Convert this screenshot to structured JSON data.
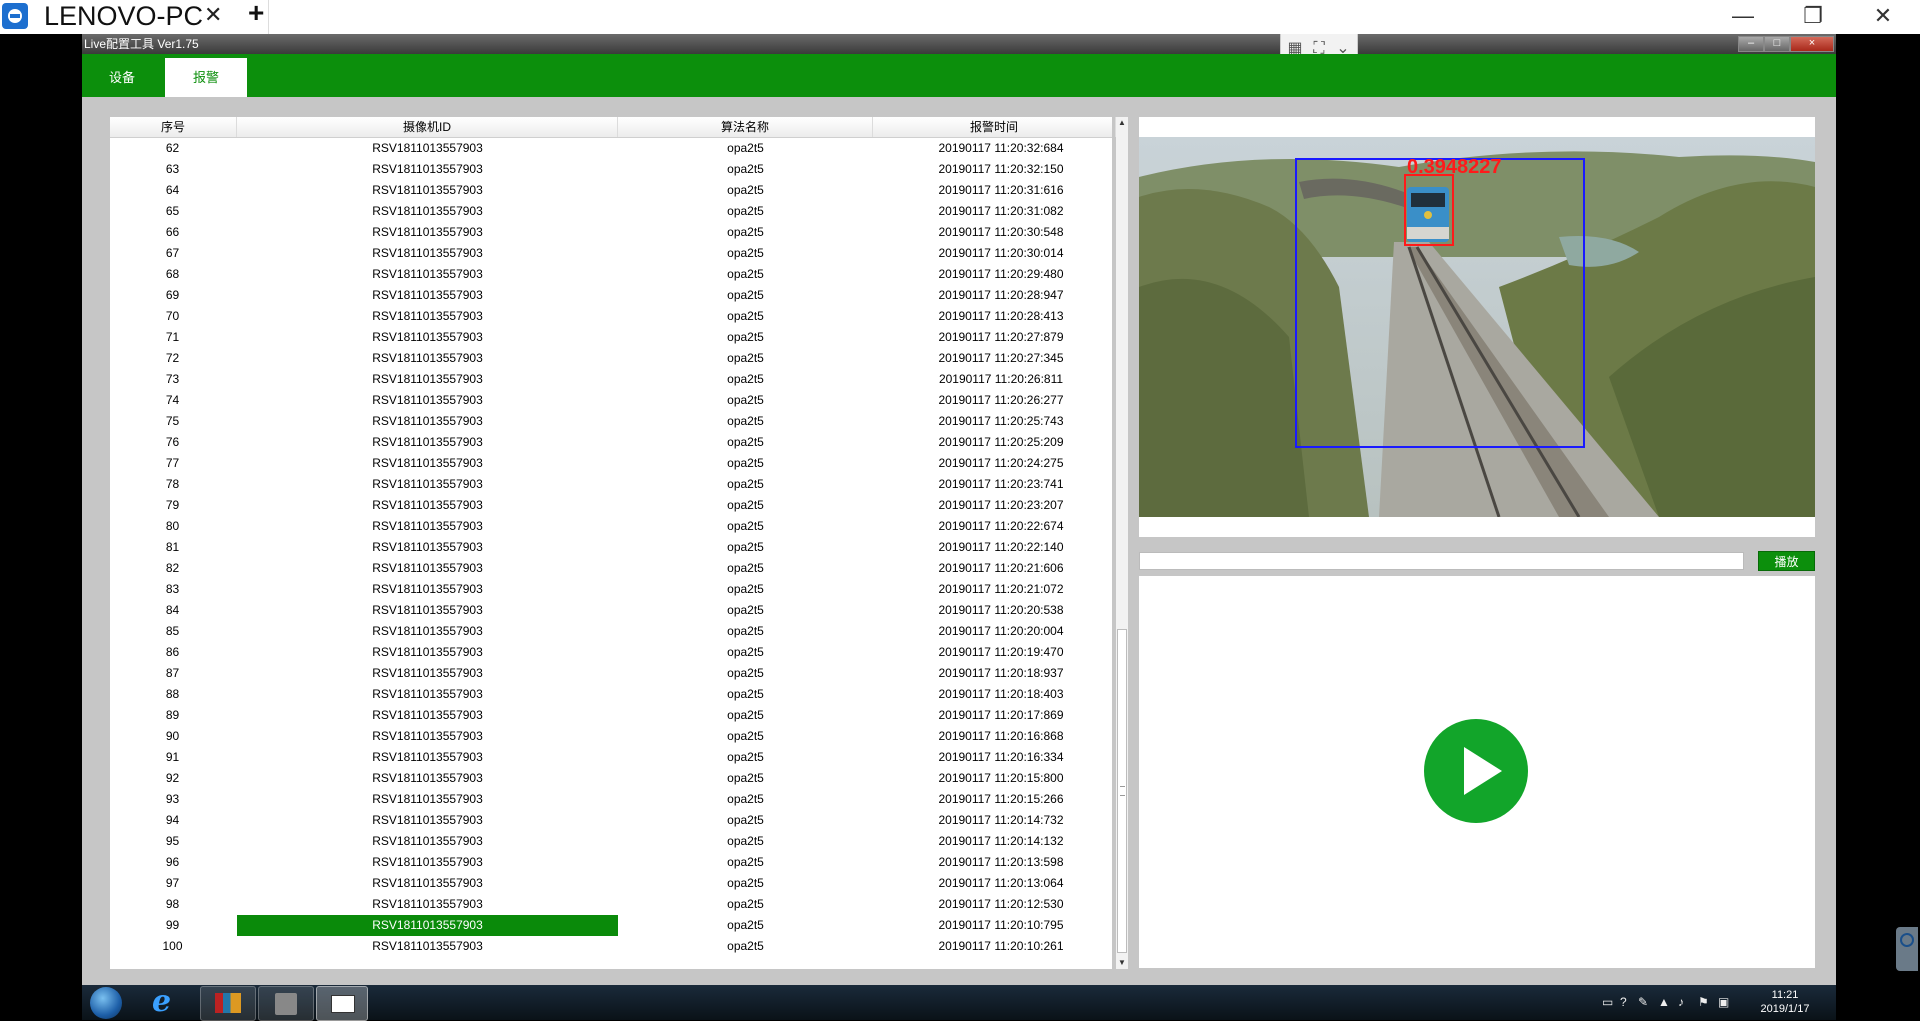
{
  "host": {
    "tab_title": "LENOVO-PC",
    "tab_close": "✕",
    "add_tab": "+",
    "minimize": "—",
    "restore": "❐",
    "close": "✕"
  },
  "app": {
    "title": "Live配置工具 Ver1.75",
    "minimize": "–",
    "maximize": "□",
    "close": "×"
  },
  "menu": {
    "tabs": [
      {
        "label": "设备",
        "active": false
      },
      {
        "label": "报警",
        "active": true
      }
    ]
  },
  "table": {
    "columns": [
      "序号",
      "摄像机ID",
      "算法名称",
      "报警时间"
    ],
    "selected_index": 99,
    "rows": [
      [
        "62",
        "RSV1811013557903",
        "opa2t5",
        "20190117 11:20:32:684"
      ],
      [
        "63",
        "RSV1811013557903",
        "opa2t5",
        "20190117 11:20:32:150"
      ],
      [
        "64",
        "RSV1811013557903",
        "opa2t5",
        "20190117 11:20:31:616"
      ],
      [
        "65",
        "RSV1811013557903",
        "opa2t5",
        "20190117 11:20:31:082"
      ],
      [
        "66",
        "RSV1811013557903",
        "opa2t5",
        "20190117 11:20:30:548"
      ],
      [
        "67",
        "RSV1811013557903",
        "opa2t5",
        "20190117 11:20:30:014"
      ],
      [
        "68",
        "RSV1811013557903",
        "opa2t5",
        "20190117 11:20:29:480"
      ],
      [
        "69",
        "RSV1811013557903",
        "opa2t5",
        "20190117 11:20:28:947"
      ],
      [
        "70",
        "RSV1811013557903",
        "opa2t5",
        "20190117 11:20:28:413"
      ],
      [
        "71",
        "RSV1811013557903",
        "opa2t5",
        "20190117 11:20:27:879"
      ],
      [
        "72",
        "RSV1811013557903",
        "opa2t5",
        "20190117 11:20:27:345"
      ],
      [
        "73",
        "RSV1811013557903",
        "opa2t5",
        "20190117 11:20:26:811"
      ],
      [
        "74",
        "RSV1811013557903",
        "opa2t5",
        "20190117 11:20:26:277"
      ],
      [
        "75",
        "RSV1811013557903",
        "opa2t5",
        "20190117 11:20:25:743"
      ],
      [
        "76",
        "RSV1811013557903",
        "opa2t5",
        "20190117 11:20:25:209"
      ],
      [
        "77",
        "RSV1811013557903",
        "opa2t5",
        "20190117 11:20:24:275"
      ],
      [
        "78",
        "RSV1811013557903",
        "opa2t5",
        "20190117 11:20:23:741"
      ],
      [
        "79",
        "RSV1811013557903",
        "opa2t5",
        "20190117 11:20:23:207"
      ],
      [
        "80",
        "RSV1811013557903",
        "opa2t5",
        "20190117 11:20:22:674"
      ],
      [
        "81",
        "RSV1811013557903",
        "opa2t5",
        "20190117 11:20:22:140"
      ],
      [
        "82",
        "RSV1811013557903",
        "opa2t5",
        "20190117 11:20:21:606"
      ],
      [
        "83",
        "RSV1811013557903",
        "opa2t5",
        "20190117 11:20:21:072"
      ],
      [
        "84",
        "RSV1811013557903",
        "opa2t5",
        "20190117 11:20:20:538"
      ],
      [
        "85",
        "RSV1811013557903",
        "opa2t5",
        "20190117 11:20:20:004"
      ],
      [
        "86",
        "RSV1811013557903",
        "opa2t5",
        "20190117 11:20:19:470"
      ],
      [
        "87",
        "RSV1811013557903",
        "opa2t5",
        "20190117 11:20:18:937"
      ],
      [
        "88",
        "RSV1811013557903",
        "opa2t5",
        "20190117 11:20:18:403"
      ],
      [
        "89",
        "RSV1811013557903",
        "opa2t5",
        "20190117 11:20:17:869"
      ],
      [
        "90",
        "RSV1811013557903",
        "opa2t5",
        "20190117 11:20:16:868"
      ],
      [
        "91",
        "RSV1811013557903",
        "opa2t5",
        "20190117 11:20:16:334"
      ],
      [
        "92",
        "RSV1811013557903",
        "opa2t5",
        "20190117 11:20:15:800"
      ],
      [
        "93",
        "RSV1811013557903",
        "opa2t5",
        "20190117 11:20:15:266"
      ],
      [
        "94",
        "RSV1811013557903",
        "opa2t5",
        "20190117 11:20:14:732"
      ],
      [
        "95",
        "RSV1811013557903",
        "opa2t5",
        "20190117 11:20:14:132"
      ],
      [
        "96",
        "RSV1811013557903",
        "opa2t5",
        "20190117 11:20:13:598"
      ],
      [
        "97",
        "RSV1811013557903",
        "opa2t5",
        "20190117 11:20:13:064"
      ],
      [
        "98",
        "RSV1811013557903",
        "opa2t5",
        "20190117 11:20:12:530"
      ],
      [
        "99",
        "RSV1811013557903",
        "opa2t5",
        "20190117 11:20:10:795"
      ],
      [
        "100",
        "RSV1811013557903",
        "opa2t5",
        "20190117 11:20:10:261"
      ]
    ]
  },
  "snapshot": {
    "score_label": "0.3948227",
    "outer_box_color": "#1a1aff",
    "inner_box_color": "#ff1a1a"
  },
  "player": {
    "url_value": "",
    "play_label": "播放"
  },
  "taskbar": {
    "time": "11:21",
    "date": "2019/1/17"
  },
  "colors": {
    "accent": "#0c8f0c",
    "selection": "#0a8a0a"
  }
}
